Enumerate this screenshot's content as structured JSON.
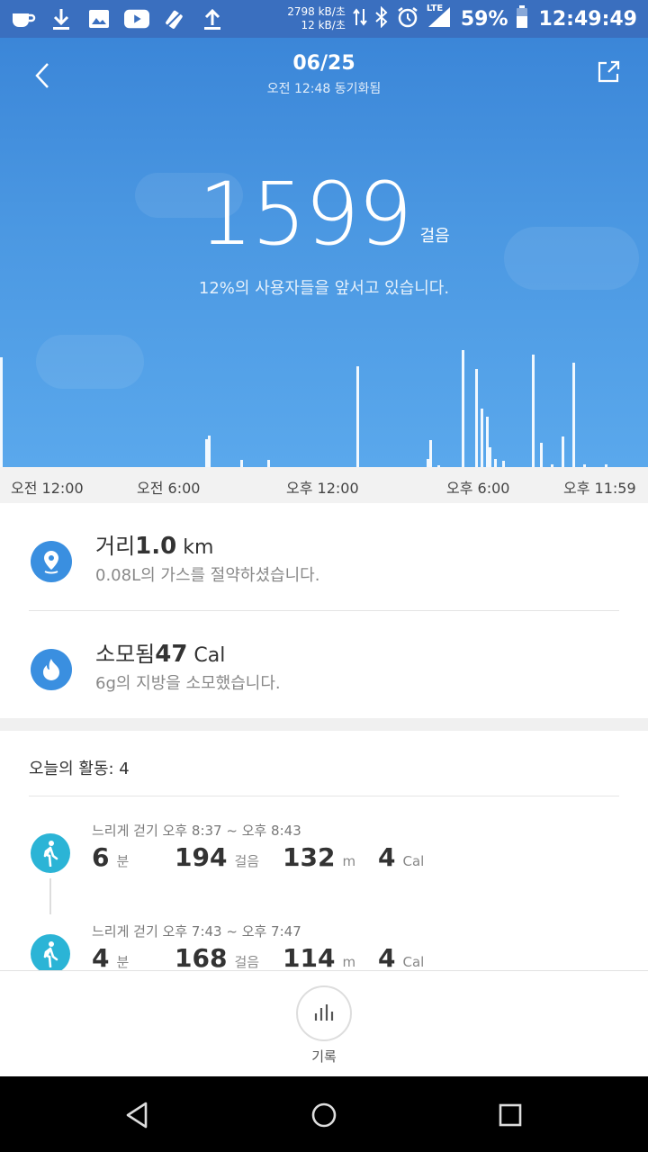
{
  "status_bar": {
    "net_down": "2798 kB/초",
    "net_up": "12 kB/초",
    "network": "LTE",
    "battery": "59%",
    "time": "12:49:49",
    "icons": [
      "coffee-icon",
      "download-icon",
      "image-icon",
      "youtube-icon",
      "data-saver-icon",
      "upload-icon",
      "data-transfer-icon",
      "bluetooth-icon",
      "alarm-icon",
      "signal-icon",
      "battery-icon"
    ]
  },
  "header": {
    "date": "06/25",
    "sync_text": "오전 12:48 동기화됨"
  },
  "summary": {
    "steps": "1599",
    "steps_unit": "걸음",
    "rank_text": "12%의 사용자들을 앞서고 있습니다."
  },
  "chart_data": {
    "type": "bar",
    "x_ticks": [
      "오전 12:00",
      "오전 6:00",
      "오후 12:00",
      "오후 6:00",
      "오후 11:59"
    ],
    "x_range_hours": [
      0,
      24
    ],
    "bars_hour": [
      0.0,
      7.6,
      7.7,
      8.9,
      9.9,
      13.2,
      15.8,
      15.9,
      16.2,
      17.1,
      17.6,
      17.8,
      18.0,
      18.1,
      18.3,
      18.6,
      19.7,
      20.0,
      20.4,
      20.8,
      21.2,
      21.6,
      22.4
    ],
    "bars_relative": [
      0.94,
      0.24,
      0.27,
      0.06,
      0.06,
      0.86,
      0.07,
      0.23,
      0.01,
      1.0,
      0.84,
      0.5,
      0.43,
      0.17,
      0.07,
      0.05,
      0.96,
      0.21,
      0.02,
      0.26,
      0.89,
      0.02,
      0.02
    ]
  },
  "stats": {
    "distance_label": "거리",
    "distance_value": "1.0",
    "distance_unit": " km",
    "distance_sub": "0.08L의 가스를 절약하셨습니다.",
    "calories_label": "소모됨",
    "calories_value": "47",
    "calories_unit": " Cal",
    "calories_sub": "6g의 지방을 소모했습니다."
  },
  "activities": {
    "heading": "오늘의 활동:  4",
    "items": [
      {
        "title": "느리게 걷기 오후 8:37 ~ 오후 8:43",
        "min": "6",
        "min_unit": "분",
        "steps": "194",
        "steps_unit": "걸음",
        "dist": "132",
        "dist_unit": "m",
        "cal": "4",
        "cal_unit": "Cal"
      },
      {
        "title": "느리게 걷기 오후 7:43 ~ 오후 7:47",
        "min": "4",
        "min_unit": "분",
        "steps": "168",
        "steps_unit": "걸음",
        "dist": "114",
        "dist_unit": "m",
        "cal": "4",
        "cal_unit": "Cal"
      }
    ]
  },
  "tabbar": {
    "records_label": "기록"
  }
}
